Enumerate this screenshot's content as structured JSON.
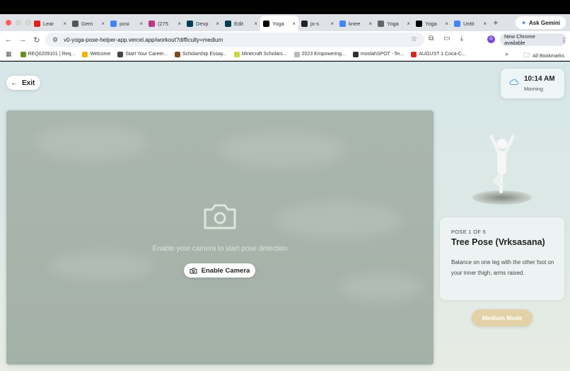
{
  "browser": {
    "tabs": [
      {
        "label": "Lear",
        "icon": "youtube-icon",
        "color": "#e62117"
      },
      {
        "label": "Gem",
        "icon": "openai-icon",
        "color": "#555555"
      },
      {
        "label": "posi",
        "icon": "docs-icon",
        "color": "#4285f4"
      },
      {
        "label": "(275",
        "icon": "instagram-icon",
        "color": "#c13584"
      },
      {
        "label": "Devp",
        "icon": "devpost-icon",
        "color": "#003e54"
      },
      {
        "label": "Edit",
        "icon": "devpost-icon",
        "color": "#003e54"
      },
      {
        "label": "Yoga",
        "icon": "v0-icon",
        "color": "#000000",
        "active": true
      },
      {
        "label": "jo-s",
        "icon": "github-icon",
        "color": "#222222"
      },
      {
        "label": "knee",
        "icon": "google-icon",
        "color": "#4285f4"
      },
      {
        "label": "Yoga",
        "icon": "chatgpt-icon",
        "color": "#666666"
      },
      {
        "label": "Yoga",
        "icon": "v0-icon",
        "color": "#000000"
      },
      {
        "label": "Untit",
        "icon": "docs-icon",
        "color": "#4285f4"
      }
    ],
    "ask_gemini": "Ask Gemini",
    "url": "v0-yoga-pose-helper-app.vercel.app/workout?difficulty=medium",
    "new_chrome": "New Chrome available",
    "avatar_letter": "G",
    "bookmarks": [
      {
        "label": "REQ0209101 | Req...",
        "color": "#6b8e23"
      },
      {
        "label": "Welcome",
        "color": "#f0b400"
      },
      {
        "label": "Start Your Career...",
        "color": "#444444"
      },
      {
        "label": "Scholarship Essay...",
        "color": "#7b4a22"
      },
      {
        "label": "Minecraft Scholars...",
        "color": "#c8d64a"
      },
      {
        "label": "2023 Empowering...",
        "color": "#bbbbbb"
      },
      {
        "label": "moolahSPOT - fin...",
        "color": "#333333"
      },
      {
        "label": "AUGUST 1 Coca-C...",
        "color": "#d6261f"
      }
    ],
    "all_bookmarks": "All Bookmarks"
  },
  "app": {
    "exit_label": "Exit",
    "time": "10:14 AM",
    "time_of_day": "Morning",
    "camera_prompt": "Enable your camera to start pose detection",
    "enable_camera_label": "Enable Camera",
    "pose_counter": "POSE 1 OF 5",
    "pose_name": "Tree Pose (Vrksasana)",
    "pose_description": "Balance on one leg with the other foot on your inner thigh, arms raised.",
    "mode_label": "Medium Mode",
    "colors": {
      "mode_button": "#e3d2a8",
      "camera_panel": "#a8b4ab"
    }
  }
}
